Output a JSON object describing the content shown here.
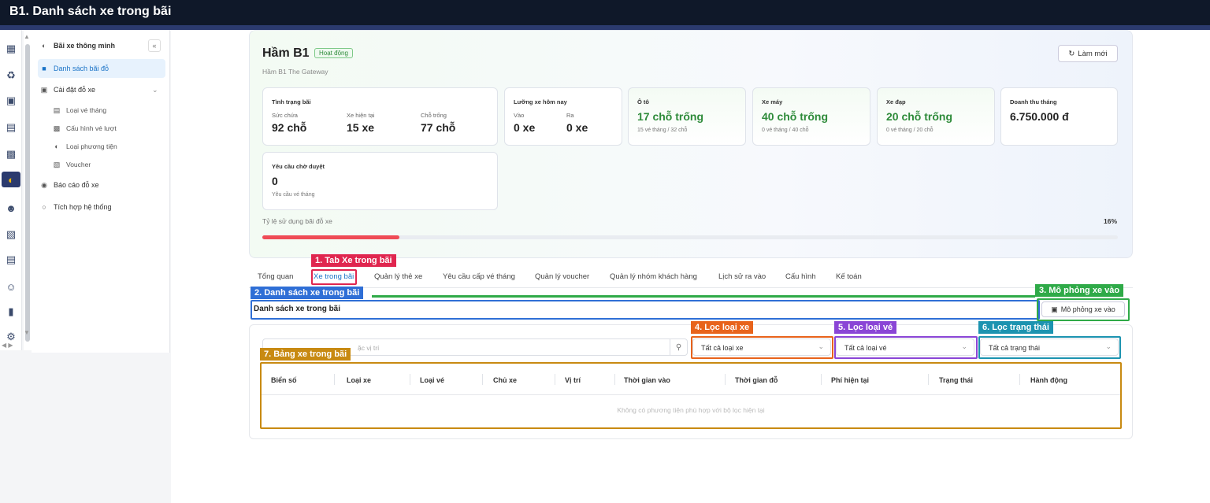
{
  "window": {
    "title": "B1. Danh sách xe trong bãi"
  },
  "rail_icons": [
    "building-icon",
    "recycle-icon",
    "chat-icon",
    "document-icon",
    "briefcase-icon",
    "car-icon",
    "users-icon",
    "office-icon",
    "store-icon",
    "person-icon",
    "chart-icon",
    "settings-icon"
  ],
  "sidebar": {
    "header": "Bãi xe thông minh",
    "items": [
      {
        "label": "Danh sách bãi đỗ"
      },
      {
        "label": "Cài đặt đỗ xe"
      },
      {
        "label": "Loại vé tháng"
      },
      {
        "label": "Cấu hình vé lượt"
      },
      {
        "label": "Loại phương tiện"
      },
      {
        "label": "Voucher"
      },
      {
        "label": "Báo cáo đỗ xe"
      },
      {
        "label": "Tích hợp hệ thống"
      }
    ]
  },
  "parking": {
    "name": "Hầm B1",
    "status": "Hoạt động",
    "subtitle": "Hầm B1 The Gateway",
    "refresh_label": "Làm mới"
  },
  "stats": {
    "status": {
      "title": "Tình trạng bãi",
      "capacity_label": "Sức chứa",
      "capacity": "92 chỗ",
      "current_label": "Xe hiện tại",
      "current": "15 xe",
      "free_label": "Chỗ trống",
      "free": "77 chỗ"
    },
    "traffic": {
      "title": "Lưỡng xe hôm nay",
      "in_label": "Vào",
      "in": "0 xe",
      "out_label": "Ra",
      "out": "0 xe"
    },
    "car": {
      "title": "Ô tô",
      "value": "17 chỗ trống",
      "note": "15 vé tháng / 32 chỗ"
    },
    "moto": {
      "title": "Xe máy",
      "value": "40 chỗ trống",
      "note": "0 vé tháng / 40 chỗ"
    },
    "bike": {
      "title": "Xe đạp",
      "value": "20 chỗ trống",
      "note": "0 vé tháng / 20 chỗ"
    },
    "revenue": {
      "title": "Doanh thu tháng",
      "value": "6.750.000 đ"
    },
    "pending": {
      "title": "Yêu cầu chờ duyệt",
      "value": "0",
      "note": "Yêu cầu vé tháng"
    }
  },
  "utilization": {
    "label": "Tỷ lệ sử dụng bãi đỗ xe",
    "percent_label": "16%",
    "percent": 16
  },
  "tabs": [
    {
      "label": "Tổng quan"
    },
    {
      "label": "Xe trong bãi"
    },
    {
      "label": "Quản lý thẻ xe"
    },
    {
      "label": "Yêu cầu cấp vé tháng"
    },
    {
      "label": "Quản lý voucher"
    },
    {
      "label": "Quản lý nhóm khách hàng"
    },
    {
      "label": "Lịch sử ra vào"
    },
    {
      "label": "Cấu hình"
    },
    {
      "label": "Kế toán"
    }
  ],
  "section": {
    "title": "Danh sách xe trong bãi",
    "simulate_label": "Mô phỏng xe vào"
  },
  "filters": {
    "search_placeholder": "ặc vị trí",
    "vehicle_type": "Tất cả loại xe",
    "ticket_type": "Tất cả loại vé",
    "status": "Tất cả trạng thái"
  },
  "table": {
    "columns": [
      "Biển số",
      "Loại xe",
      "Loại vé",
      "Chủ xe",
      "Vị trí",
      "Thời gian vào",
      "Thời gian đỗ",
      "Phí hiện tại",
      "Trạng thái",
      "Hành động"
    ],
    "empty_text": "Không có phương tiện phù hợp với bộ lọc hiện tại"
  },
  "annotations": [
    {
      "label": "1. Tab Xe trong bãi",
      "color": "#e0264f"
    },
    {
      "label": "2. Danh sách xe trong bãi",
      "color": "#2f6fd6"
    },
    {
      "label": "3. Mô phỏng xe vào",
      "color": "#2faa48"
    },
    {
      "label": "4. Lọc loại xe",
      "color": "#e8631b"
    },
    {
      "label": "5. Lọc loại vé",
      "color": "#8a45d6"
    },
    {
      "label": "6. Lọc trạng thái",
      "color": "#1c93b0"
    },
    {
      "label": "7. Bảng xe trong bãi",
      "color": "#c88a12"
    }
  ]
}
